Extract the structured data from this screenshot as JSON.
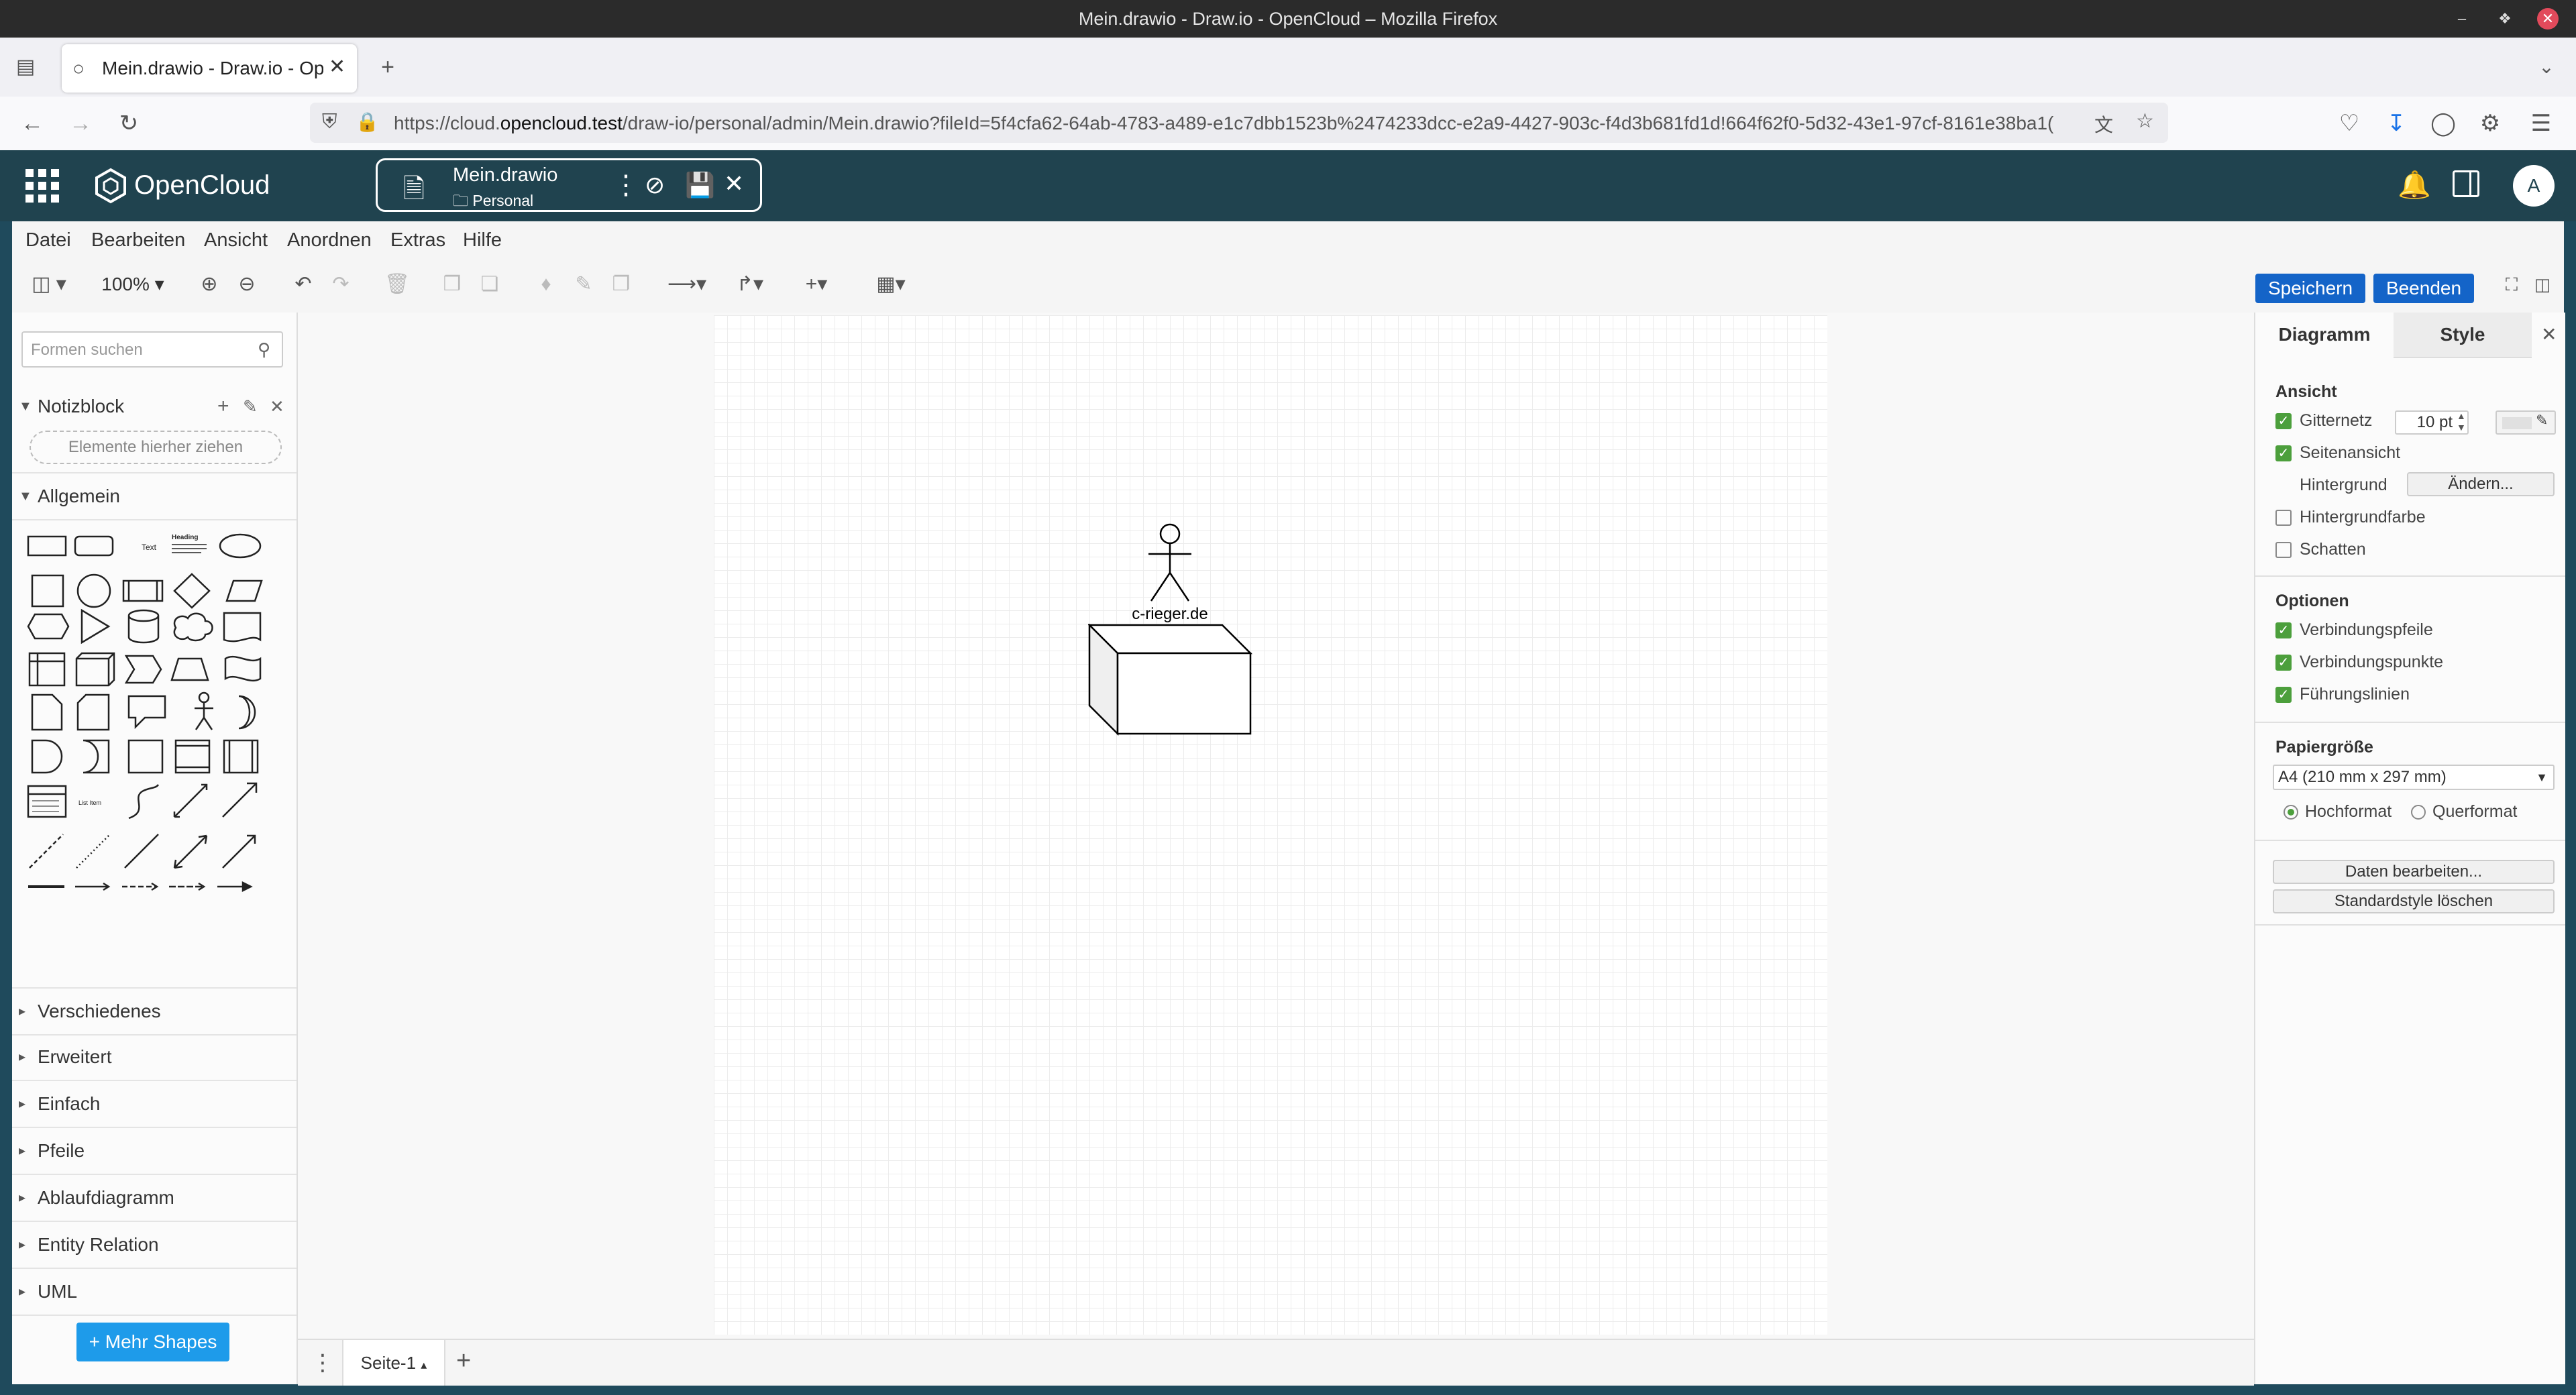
{
  "window": {
    "title": "Mein.drawio - Draw.io - OpenCloud – Mozilla Firefox"
  },
  "browser": {
    "tab_title": "Mein.drawio - Draw.io - Ope",
    "url_prefix": "https://cloud.",
    "url_domain": "opencloud.test",
    "url_rest": "/draw-io/personal/admin/Mein.drawio?fileId=5f4cfa62-64ab-4783-a489-e1c7dbb1523b%2474233dcc-e2a9-4427-903c-f4d3b681fd1d!664f62f0-5d32-43e1-97cf-8161e38ba1("
  },
  "opencloud": {
    "brand": "OpenCloud",
    "file_name": "Mein.drawio",
    "file_location": "Personal",
    "avatar_initial": "A"
  },
  "menu": [
    "Datei",
    "Bearbeiten",
    "Ansicht",
    "Anordnen",
    "Extras",
    "Hilfe"
  ],
  "toolbar": {
    "zoom": "100%",
    "save_label": "Speichern",
    "exit_label": "Beenden"
  },
  "left_panel": {
    "search_placeholder": "Formen suchen",
    "scratchpad_title": "Notizblock",
    "scratchpad_drop": "Elemente hierher ziehen",
    "general_title": "Allgemein",
    "shape_text": "Text",
    "shape_heading": "Heading",
    "shape_list": "List Item",
    "sections": [
      "Verschiedenes",
      "Erweitert",
      "Einfach",
      "Pfeile",
      "Ablaufdiagramm",
      "Entity Relation",
      "UML"
    ],
    "more_shapes": "+ Mehr Shapes"
  },
  "canvas": {
    "actor_label": "c-rieger.de",
    "page_tab": "Seite-1"
  },
  "right_panel": {
    "tab_diagram": "Diagramm",
    "tab_style": "Style",
    "view_title": "Ansicht",
    "grid_label": "Gitternetz",
    "grid_size": "10 pt",
    "page_view_label": "Seitenansicht",
    "background_label": "Hintergrund",
    "change_button": "Ändern...",
    "bg_color_label": "Hintergrundfarbe",
    "shadow_label": "Schatten",
    "options_title": "Optionen",
    "conn_arrows": "Verbindungspfeile",
    "conn_points": "Verbindungspunkte",
    "guides": "Führungslinien",
    "paper_title": "Papiergröße",
    "paper_size": "A4 (210 mm x 297 mm)",
    "portrait": "Hochformat",
    "landscape": "Querformat",
    "edit_data": "Daten bearbeiten...",
    "clear_style": "Standardstyle löschen"
  },
  "colors": {
    "brand_header": "#20434f",
    "primary_button": "#1464c8",
    "more_shapes": "#1e9bea",
    "checkbox_on": "#4c9f3c"
  }
}
